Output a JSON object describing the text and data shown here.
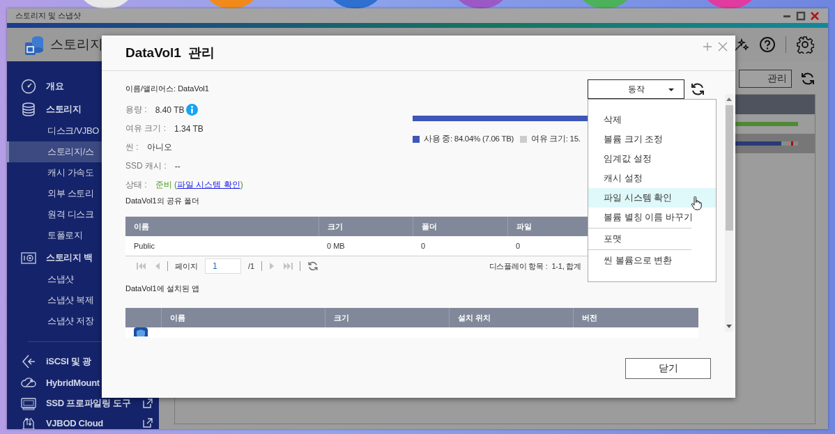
{
  "window": {
    "title": "스토리지 및 스냅샷"
  },
  "header": {
    "title": "스토리지"
  },
  "sidebar": {
    "items": [
      {
        "label": "개요",
        "selected": false
      },
      {
        "label": "스토리지",
        "selected": false,
        "children": [
          {
            "label": "디스크/VJBO",
            "selected": false
          },
          {
            "label": "스토리지/스",
            "selected": true
          },
          {
            "label": "캐시 가속도",
            "selected": false
          },
          {
            "label": "외부 스토리",
            "selected": false
          },
          {
            "label": "원격 디스크",
            "selected": false
          },
          {
            "label": "토폴로지",
            "selected": false
          }
        ]
      },
      {
        "label": "스토리지 백",
        "selected": false,
        "children": [
          {
            "label": "스냅샷",
            "selected": false
          },
          {
            "label": "스냅샷 복제",
            "selected": false
          },
          {
            "label": "스냅샷 저장",
            "selected": false
          }
        ]
      },
      {
        "label": "iSCSI 및 광",
        "selected": false
      },
      {
        "label": "HybridMount",
        "selected": false
      },
      {
        "label": "SSD 프로파일링 도구",
        "selected": false,
        "external": true
      },
      {
        "label": "VJBOD Cloud",
        "selected": false,
        "external": true
      }
    ]
  },
  "main": {
    "manage_button": "관리"
  },
  "dialog": {
    "title": "DataVol1  관리",
    "alias": {
      "label": "이름/앨리어스:",
      "value": "DataVol1"
    },
    "fields": [
      {
        "label": "용량 :",
        "value": "8.40 TB",
        "info": true
      },
      {
        "label": "여유 크기 :",
        "value": "1.34 TB",
        "info": false
      },
      {
        "label": "씬 :",
        "value": "아니오",
        "info": false
      },
      {
        "label": "SSD 캐시 :",
        "value": "--",
        "info": false
      }
    ],
    "status": {
      "label": "상태 :",
      "prefix": "준비 (",
      "link": "파일 시스템 확인",
      "suffix": ")"
    },
    "usage": {
      "level": 0.8404,
      "used_legend": "사용 중: 84.04% (7.06 TB)",
      "free_legend": "여유 크기: 15."
    },
    "shared_folders": {
      "title": "DataVol1의 공유 폴더",
      "columns": [
        "이름",
        "크기",
        "폴더",
        "파일"
      ],
      "rows": [
        [
          "Public",
          "0 MB",
          "0",
          "0"
        ]
      ]
    },
    "pager": {
      "page_label": "페이지",
      "page": "1",
      "total": "/1",
      "display": "디스플레이 항목 :  1-1, 합계"
    },
    "apps": {
      "title": "DataVol1에 설치된 앱",
      "columns": [
        "",
        "이름",
        "크기",
        "설치 위치",
        "버전"
      ]
    },
    "action_menu": {
      "button": "동작",
      "items": [
        {
          "label": "삭제",
          "highlighted": false,
          "separator_above": false
        },
        {
          "label": "볼륨 크기 조정",
          "highlighted": false,
          "separator_above": false
        },
        {
          "label": "임계값 설정",
          "highlighted": false,
          "separator_above": false
        },
        {
          "label": "캐시 설정",
          "highlighted": false,
          "separator_above": false
        },
        {
          "label": "파일 시스템 확인",
          "highlighted": true,
          "separator_above": false
        },
        {
          "label": "볼륨 별칭 이름 바꾸기",
          "highlighted": false,
          "separator_above": false
        },
        {
          "label": "포맷",
          "highlighted": false,
          "separator_above": true
        },
        {
          "label": "씬 볼륨으로 변환",
          "highlighted": false,
          "separator_above": true
        }
      ]
    },
    "close_button": "닫기"
  }
}
